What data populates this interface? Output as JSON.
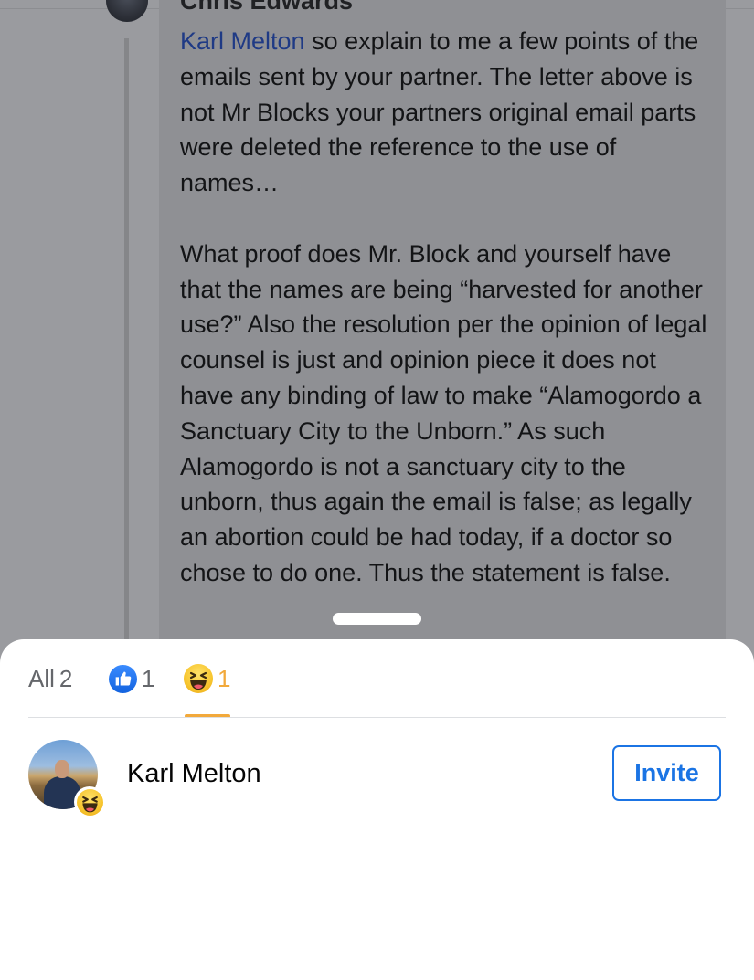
{
  "comment": {
    "author": "Chris Edwards",
    "mention": "Karl Melton",
    "paragraph1_rest": " so explain to me a few points of the emails sent by your partner. The letter above is not Mr Blocks your partners original email parts were deleted the reference to the use of names…",
    "paragraph2": "What proof does Mr. Block and yourself have that the names are being “harvested for another use?” Also the resolution per the opinion of legal counsel is just and opinion piece it does not have any binding of law to make “Alamogordo a Sanctuary City to the Unborn.” As such Alamogordo is not a sanctuary city to the unborn, thus again the email is false; as legally an abortion could be had today, if a doctor so chose to do one. Thus the statement is false."
  },
  "reactions_sheet": {
    "tabs": [
      {
        "label": "All",
        "count": "2",
        "icon": null
      },
      {
        "label": "",
        "count": "1",
        "icon": "like-icon"
      },
      {
        "label": "",
        "count": "1",
        "icon": "haha-icon",
        "selected": true
      }
    ],
    "people": [
      {
        "name": "Karl Melton",
        "reaction_icon": "haha-icon",
        "action_label": "Invite"
      }
    ]
  },
  "colors": {
    "overlay": "#9a9b9f",
    "accent_blue": "#1b74e4",
    "haha_orange": "#f2a93b"
  }
}
